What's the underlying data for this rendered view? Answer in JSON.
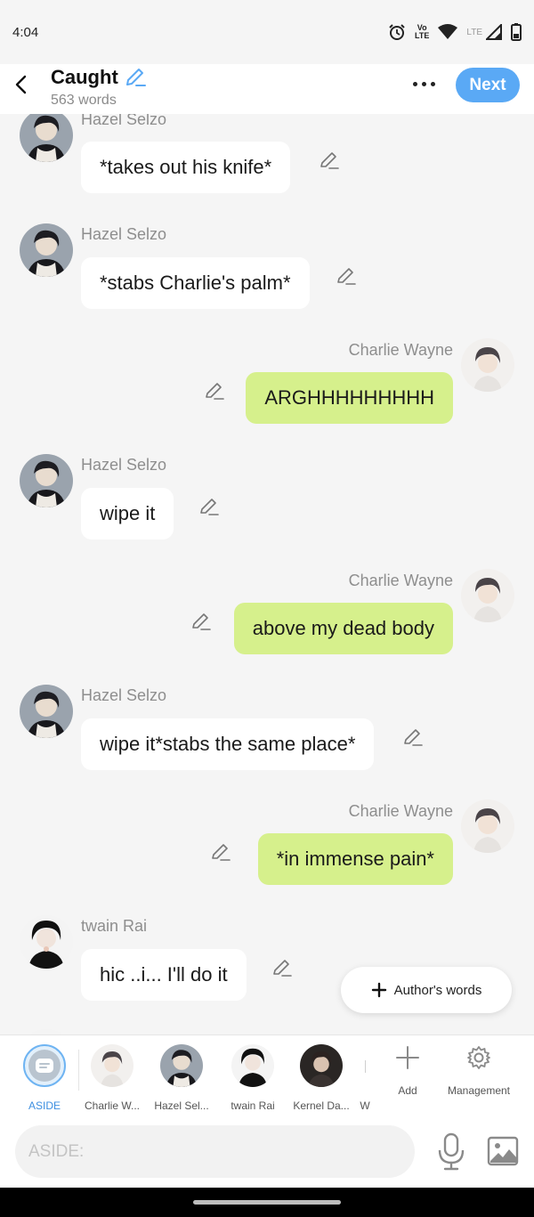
{
  "status_bar": {
    "time": "4:04",
    "volte_line1": "Vo",
    "volte_line2": "LTE",
    "lte_label": "LTE"
  },
  "header": {
    "title": "Caught",
    "word_count": "563 words",
    "next_label": "Next"
  },
  "messages": [
    {
      "sender": "Hazel Selzo",
      "text": "*takes out his knife*",
      "side": "left",
      "avatar": "hazel"
    },
    {
      "sender": "Hazel Selzo",
      "text": "*stabs Charlie's palm*",
      "side": "left",
      "avatar": "hazel"
    },
    {
      "sender": "Charlie Wayne",
      "text": "ARGHHHHHHHHH",
      "side": "right",
      "avatar": "charlie"
    },
    {
      "sender": "Hazel Selzo",
      "text": "wipe it",
      "side": "left",
      "avatar": "hazel"
    },
    {
      "sender": "Charlie Wayne",
      "text": "above my dead body",
      "side": "right",
      "avatar": "charlie"
    },
    {
      "sender": "Hazel Selzo",
      "text": "wipe it*stabs the same place*",
      "side": "left",
      "avatar": "hazel"
    },
    {
      "sender": "Charlie Wayne",
      "text": "*in immense pain*",
      "side": "right",
      "avatar": "charlie"
    },
    {
      "sender": "twain Rai",
      "text": "hic ..i... I'll do it",
      "side": "left",
      "avatar": "twain"
    }
  ],
  "authors_words_label": "Author's words",
  "character_bar": {
    "aside_label": "ASIDE",
    "characters": [
      "Charlie W...",
      "Hazel Sel...",
      "twain Rai",
      "Kernel Da...",
      "W"
    ],
    "add_label": "Add",
    "management_label": "Management"
  },
  "input": {
    "placeholder": "ASIDE:"
  },
  "colors": {
    "accent": "#5aa9f5",
    "right_bubble": "#d6f08c",
    "left_bubble": "#ffffff",
    "background": "#f5f5f5"
  },
  "icons": [
    "back-arrow-icon",
    "pencil-icon",
    "more-icon",
    "plus-icon",
    "gear-icon",
    "microphone-icon",
    "image-icon",
    "alarm-icon",
    "wifi-icon",
    "signal-icon",
    "battery-icon",
    "aside-chat-icon"
  ]
}
